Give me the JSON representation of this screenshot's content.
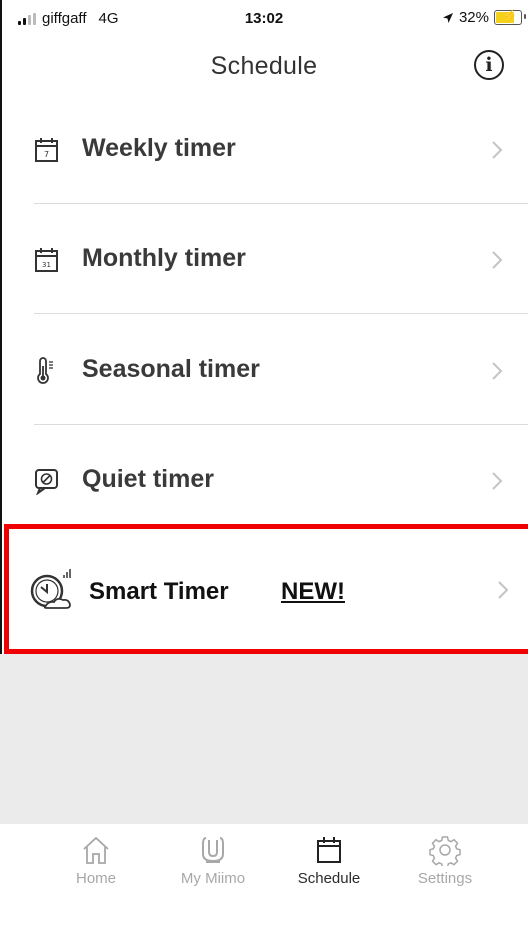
{
  "status_bar": {
    "carrier": "giffgaff",
    "network": "4G",
    "time": "13:02",
    "battery": "32%"
  },
  "header": {
    "title": "Schedule",
    "info_icon": "info-icon"
  },
  "list": [
    {
      "label": "Weekly timer",
      "icon": "calendar-7-icon"
    },
    {
      "label": "Monthly timer",
      "icon": "calendar-31-icon"
    },
    {
      "label": "Seasonal timer",
      "icon": "thermometer-icon"
    },
    {
      "label": "Quiet timer",
      "icon": "quiet-icon"
    }
  ],
  "smart_timer": {
    "label": "Smart Timer",
    "badge": "NEW!",
    "icon": "smart-clock-icon",
    "highlight_color": "#f00000"
  },
  "tabs": [
    {
      "label": "Home",
      "icon": "home-icon",
      "active": false
    },
    {
      "label": "My Miimo",
      "icon": "mower-icon",
      "active": false
    },
    {
      "label": "Schedule",
      "icon": "calendar-icon",
      "active": true
    },
    {
      "label": "Settings",
      "icon": "gear-icon",
      "active": false
    }
  ],
  "colors": {
    "inactive_tab": "#a8a8a8",
    "active_tab": "#2b2b2b",
    "empty_area": "#ebebeb"
  }
}
